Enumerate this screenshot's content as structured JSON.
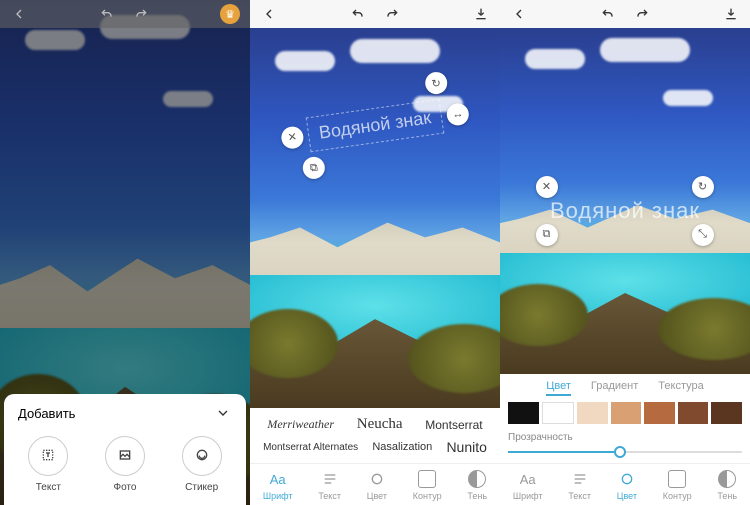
{
  "panel1": {
    "sheet_title": "Добавить",
    "add": [
      {
        "label": "Текст",
        "icon": "text-icon"
      },
      {
        "label": "Фото",
        "icon": "photo-icon"
      },
      {
        "label": "Стикер",
        "icon": "sticker-icon"
      }
    ]
  },
  "panel2": {
    "watermark_text": "Водяной знак",
    "fonts_row1": [
      "Merriweather",
      "Neucha",
      "Montserrat"
    ],
    "fonts_row2": [
      "Montserrat Alternates",
      "Nasalization",
      "Nunito"
    ]
  },
  "panel3": {
    "watermark_text": "Водяной знак",
    "color_tabs": [
      "Цвет",
      "Градиент",
      "Текстура"
    ],
    "active_color_tab": "Цвет",
    "swatches": [
      "#111111",
      "#ffffff",
      "#f0d9c0",
      "#d9a074",
      "#b56b3f",
      "#7f4a2d",
      "#5a3520"
    ],
    "opacity_label": "Прозрачность",
    "opacity_value": 48
  },
  "bottom_tabs": [
    {
      "label": "Шрифт",
      "key": "font"
    },
    {
      "label": "Текст",
      "key": "text"
    },
    {
      "label": "Цвет",
      "key": "color"
    },
    {
      "label": "Контур",
      "key": "outline"
    },
    {
      "label": "Тень",
      "key": "shadow"
    }
  ],
  "panel2_active_tab": "font",
  "panel3_active_tab": "color"
}
